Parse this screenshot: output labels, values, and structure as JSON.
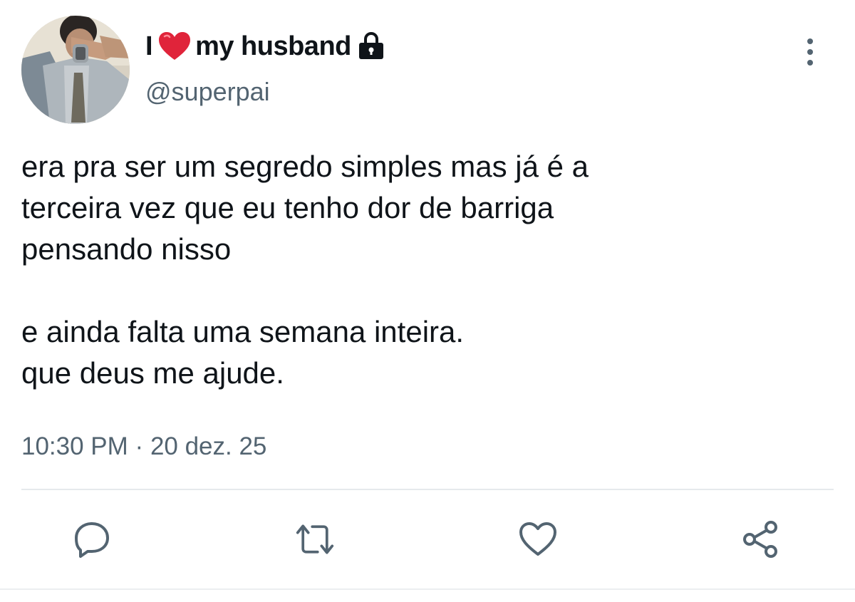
{
  "tweet": {
    "display_name_prefix": "I",
    "display_name_suffix": "my husband",
    "handle": "@superpai",
    "text_lines": [
      "era pra ser um segredo simples mas já é a",
      "terceira vez que eu tenho dor de barriga",
      "pensando nisso",
      "e ainda falta uma semana inteira.",
      "que deus me ajude."
    ],
    "time": "10:30 PM",
    "separator": "·",
    "date": "20 dez. 25"
  },
  "icons": {
    "name_emoji": "red-heart-icon",
    "protected": "lock-icon",
    "more": "more-vertical-icon",
    "reply": "reply-icon",
    "retweet": "retweet-icon",
    "like": "heart-outline-icon",
    "share": "share-icon"
  },
  "colors": {
    "text_primary": "#0f1419",
    "text_secondary": "#536471",
    "icon": "#536471",
    "heart_emoji": "#e0243a"
  }
}
